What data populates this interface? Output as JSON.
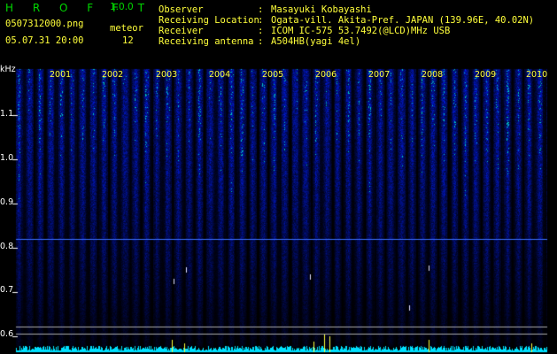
{
  "app": {
    "title": "H R O F F T",
    "version": "1.0.0"
  },
  "file": {
    "name": "0507312000.png",
    "timestamp": "05.07.31 20:00",
    "counter_label": "meteor",
    "counter_value": "12"
  },
  "info": [
    {
      "label": "Observer",
      "value": "Masayuki Kobayashi"
    },
    {
      "label": "Receiving Location",
      "value": "Ogata-vill. Akita-Pref. JAPAN (139.96E, 40.02N)"
    },
    {
      "label": "Receiver",
      "value": "ICOM IC-575 53.7492(@LCD)MHz USB"
    },
    {
      "label": "Receiving antenna",
      "value": "A504HB(yagi 4el)"
    }
  ],
  "y_axis": {
    "unit": "kHz",
    "ticks": [
      "1.1",
      "1.0",
      "0.9",
      "0.8",
      "0.7",
      "0.6"
    ]
  },
  "x_axis": {
    "ticks": [
      "2001",
      "2002",
      "2003",
      "2004",
      "2005",
      "2006",
      "2007",
      "2008",
      "2009",
      "2010"
    ]
  },
  "colors": {
    "background": "#000000",
    "header_green": "#00d800",
    "header_yellow": "#ffff3a",
    "spectrum_blue": "#1030d0",
    "noise_cyan": "#00e0ff"
  }
}
